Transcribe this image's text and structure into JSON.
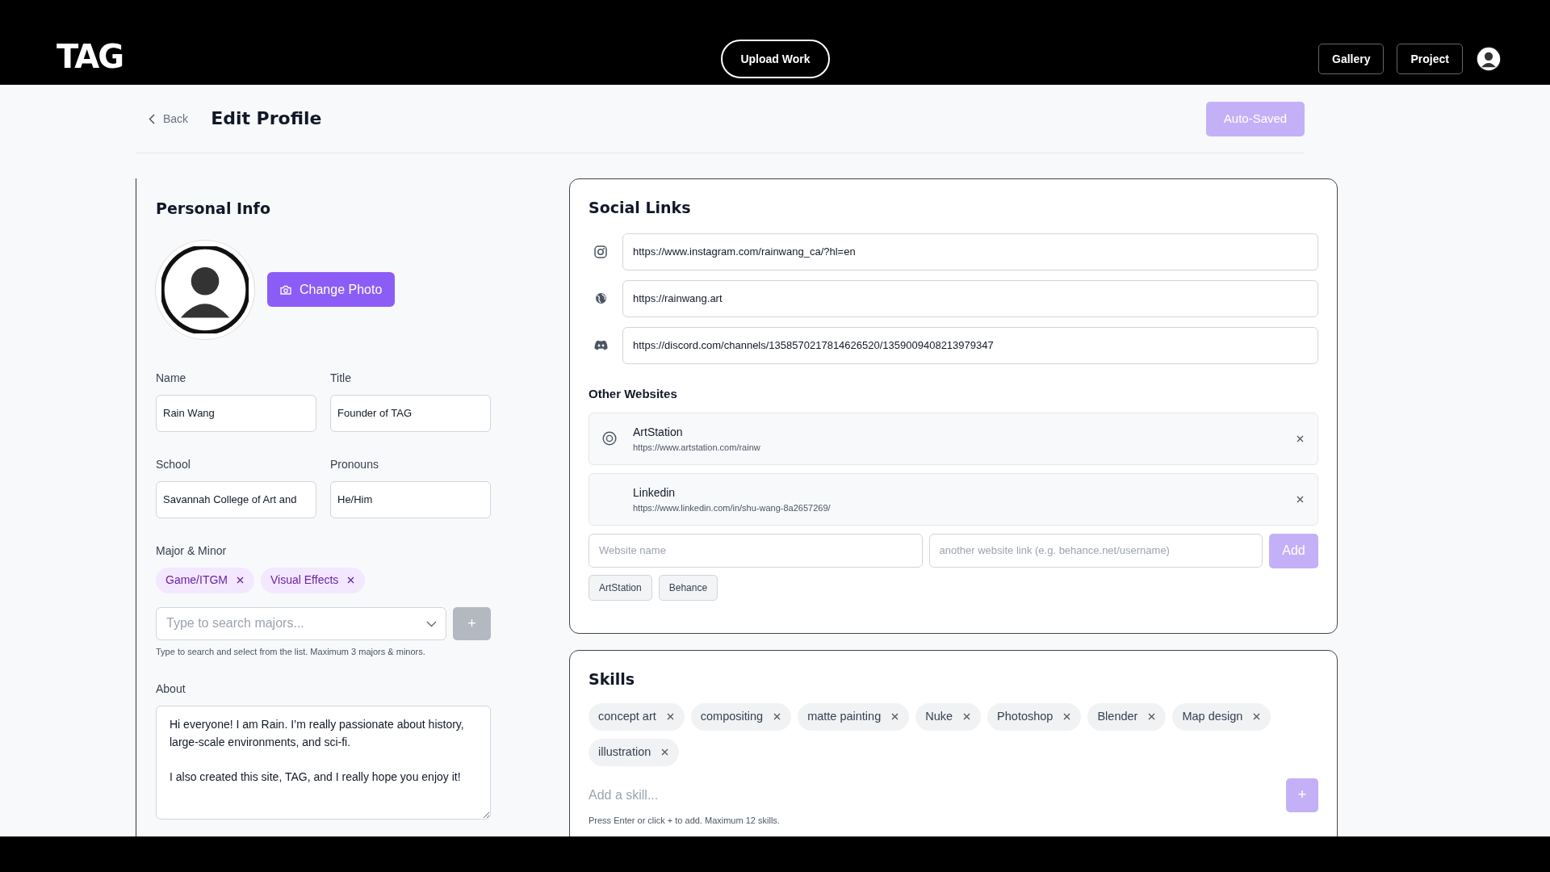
{
  "header": {
    "logo": "TAG",
    "upload_button": "Upload Work",
    "nav_buttons": [
      "Gallery",
      "Project"
    ]
  },
  "topbar": {
    "back": "Back",
    "title": "Edit Profile",
    "status_button": {
      "label": "Auto-Saved",
      "disabled": true
    }
  },
  "personal_info": {
    "heading": "Personal Info",
    "change_photo": "Change Photo",
    "fields": [
      {
        "label": "Name",
        "value": "Rain Wang"
      },
      {
        "label": "Title",
        "value": "Founder of TAG"
      },
      {
        "label": "School",
        "value": "Savannah College of Art and"
      },
      {
        "label": "Pronouns",
        "value": "He/Him"
      }
    ],
    "majors": {
      "label": "Major & Minor",
      "tags": [
        "Game/ITGM",
        "Visual Effects"
      ],
      "placeholder": "Type to search majors...",
      "add_button": {
        "label": "+",
        "disabled": true
      },
      "hint": "Type to search and select from the list. Maximum 3 majors & minors."
    },
    "about": {
      "label": "About",
      "value": "Hi everyone! I am Rain. I’m really passionate about history, large-scale environments, and sci-fi.\n\nI also created this site, TAG, and I really hope you enjoy it!"
    }
  },
  "social_links": {
    "heading": "Social Links",
    "links": [
      {
        "kind": "instagram",
        "value": "https://www.instagram.com/rainwang_ca/?hl=en"
      },
      {
        "kind": "website",
        "value": "https://rainwang.art"
      },
      {
        "kind": "discord",
        "value": "https://discord.com/channels/1358570217814626520/1359009408213979347"
      }
    ],
    "other_heading": "Other Websites",
    "sites": [
      {
        "kind": "artstation",
        "name": "ArtStation",
        "url": "https://www.artstation.com/rainw"
      },
      {
        "kind": "none",
        "name": "Linkedin",
        "url": "https://www.linkedin.com/in/shu-wang-8a2657269/"
      }
    ],
    "name_placeholder": "Website name",
    "link_placeholder": "another website link (e.g. behance.net/username)",
    "add_button": {
      "label": "Add",
      "disabled": true
    },
    "suggestions": [
      "ArtStation",
      "Behance"
    ]
  },
  "skills": {
    "heading": "Skills",
    "tags": [
      "concept art",
      "compositing",
      "matte painting",
      "Nuke",
      "Photoshop",
      "Blender",
      "Map design",
      "illustration"
    ],
    "placeholder": "Add a skill...",
    "add_button": {
      "label": "+",
      "disabled": true
    },
    "hint": "Press Enter or click + to add. Maximum 12 skills."
  }
}
